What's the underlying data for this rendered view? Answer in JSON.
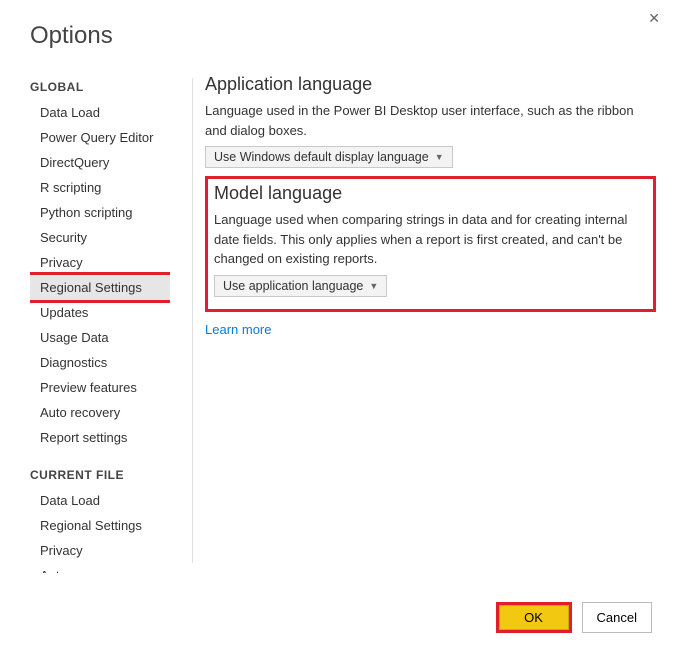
{
  "window": {
    "title": "Options",
    "close_icon": "✕"
  },
  "sidebar": {
    "global_label": "GLOBAL",
    "global_items": [
      "Data Load",
      "Power Query Editor",
      "DirectQuery",
      "R scripting",
      "Python scripting",
      "Security",
      "Privacy",
      "Regional Settings",
      "Updates",
      "Usage Data",
      "Diagnostics",
      "Preview features",
      "Auto recovery",
      "Report settings"
    ],
    "selected_global_index": 7,
    "current_label": "CURRENT FILE",
    "current_items": [
      "Data Load",
      "Regional Settings",
      "Privacy",
      "Auto recovery"
    ]
  },
  "main": {
    "app_lang": {
      "title": "Application language",
      "desc": "Language used in the Power BI Desktop user interface, such as the ribbon and dialog boxes.",
      "dropdown": "Use Windows default display language"
    },
    "model_lang": {
      "title": "Model language",
      "desc": "Language used when comparing strings in data and for creating internal date fields. This only applies when a report is first created, and can't be changed on existing reports.",
      "dropdown": "Use application language"
    },
    "learn_more": "Learn more"
  },
  "footer": {
    "ok": "OK",
    "cancel": "Cancel"
  }
}
